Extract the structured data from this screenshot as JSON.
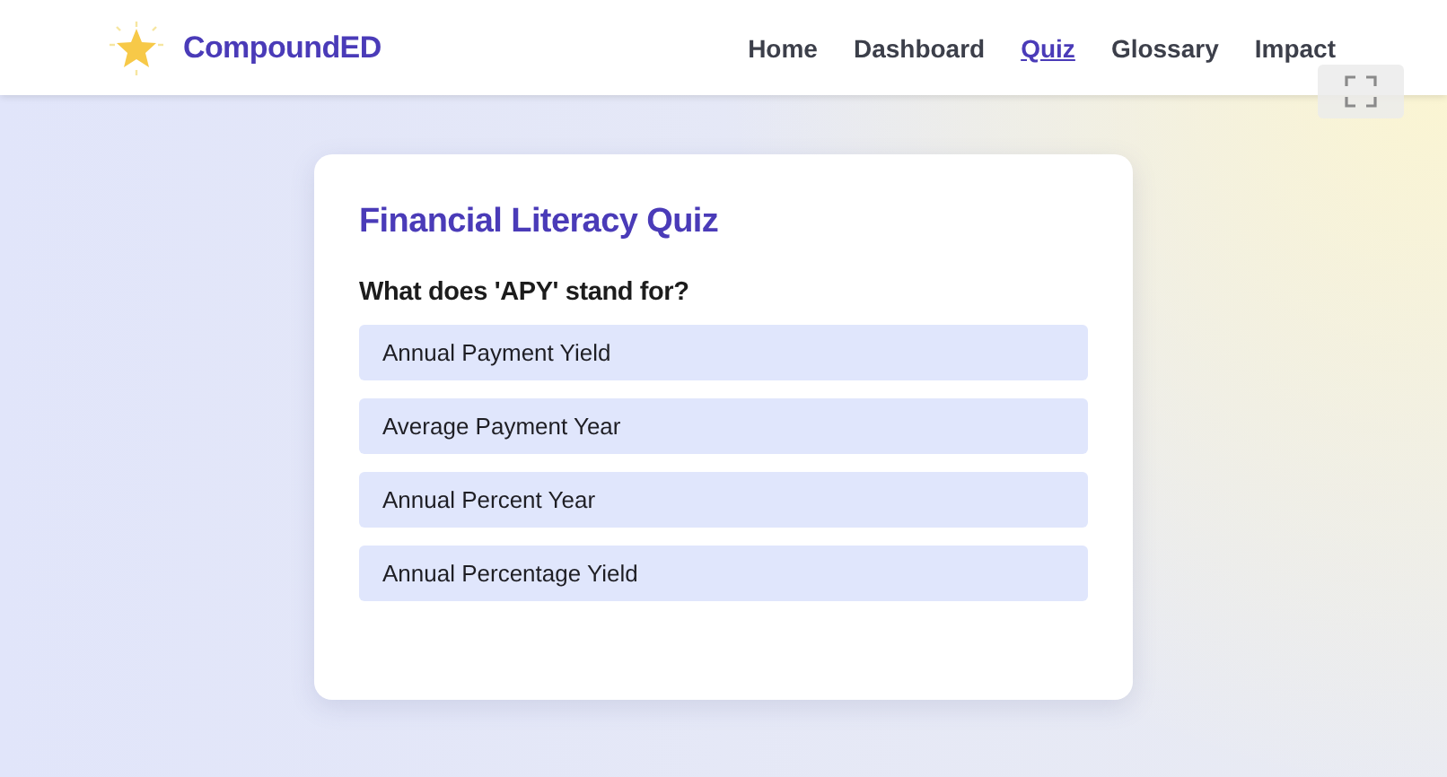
{
  "header": {
    "brand": "CompoundED",
    "nav": [
      {
        "label": "Home",
        "selected": false
      },
      {
        "label": "Dashboard",
        "selected": false
      },
      {
        "label": "Quiz",
        "selected": true
      },
      {
        "label": "Glossary",
        "selected": false
      },
      {
        "label": "Impact",
        "selected": false
      }
    ]
  },
  "quiz": {
    "title": "Financial Literacy Quiz",
    "question": "What does 'APY' stand for?",
    "options": [
      "Annual Payment Yield",
      "Average Payment Year",
      "Annual Percent Year",
      "Annual Percentage Yield"
    ]
  }
}
